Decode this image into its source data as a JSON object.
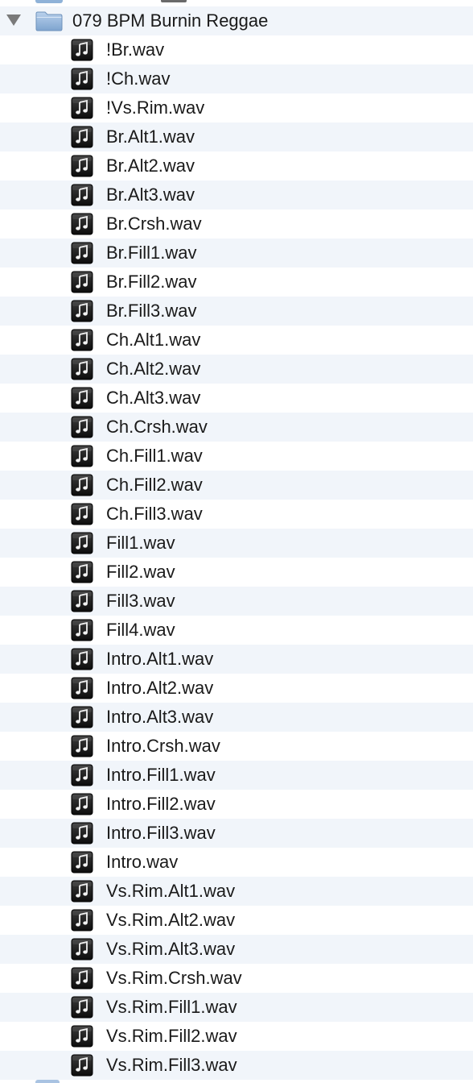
{
  "folder": {
    "name": "079 BPM Burnin Reggae",
    "expanded": true,
    "icon": "folder-icon",
    "color": "#8fb2d8"
  },
  "files": [
    "!Br.wav",
    "!Ch.wav",
    "!Vs.Rim.wav",
    "Br.Alt1.wav",
    "Br.Alt2.wav",
    "Br.Alt3.wav",
    "Br.Crsh.wav",
    "Br.Fill1.wav",
    "Br.Fill2.wav",
    "Br.Fill3.wav",
    "Ch.Alt1.wav",
    "Ch.Alt2.wav",
    "Ch.Alt3.wav",
    "Ch.Crsh.wav",
    "Ch.Fill1.wav",
    "Ch.Fill2.wav",
    "Ch.Fill3.wav",
    "Fill1.wav",
    "Fill2.wav",
    "Fill3.wav",
    "Fill4.wav",
    "Intro.Alt1.wav",
    "Intro.Alt2.wav",
    "Intro.Alt3.wav",
    "Intro.Crsh.wav",
    "Intro.Fill1.wav",
    "Intro.Fill2.wav",
    "Intro.Fill3.wav",
    "Intro.wav",
    "Vs.Rim.Alt1.wav",
    "Vs.Rim.Alt2.wav",
    "Vs.Rim.Alt3.wav",
    "Vs.Rim.Crsh.wav",
    "Vs.Rim.Fill1.wav",
    "Vs.Rim.Fill2.wav",
    "Vs.Rim.Fill3.wav"
  ],
  "file_icon": "audio-file-icon",
  "colors": {
    "stripe": "#f1f5fa",
    "text": "#1a1a1a",
    "disclosure": "#7a7a7a"
  }
}
